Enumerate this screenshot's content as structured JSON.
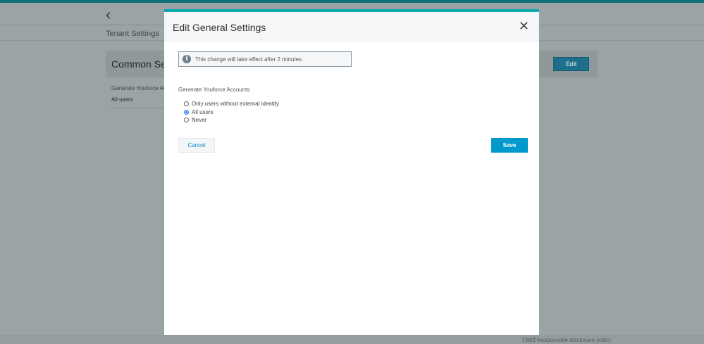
{
  "page": {
    "breadcrumb": "Tenant Settings",
    "card_title": "Common Settings",
    "edit_label": "Edit",
    "field_label": "Generate Youforce Accounts",
    "field_value": "All users",
    "footer_logo": "raet",
    "footer_link": "Responsible disclosure policy"
  },
  "modal": {
    "title": "Edit General Settings",
    "info": "This change will take effect after 2 minutes.",
    "group_label": "Generate Youforce Accounts",
    "options": [
      {
        "label": "Only users without external identity",
        "selected": false
      },
      {
        "label": "All users",
        "selected": true
      },
      {
        "label": "Never",
        "selected": false
      }
    ],
    "cancel": "Cancel",
    "save": "Save"
  },
  "colors": {
    "accent": "#0099cc",
    "top_bar": "#13a8b0"
  }
}
